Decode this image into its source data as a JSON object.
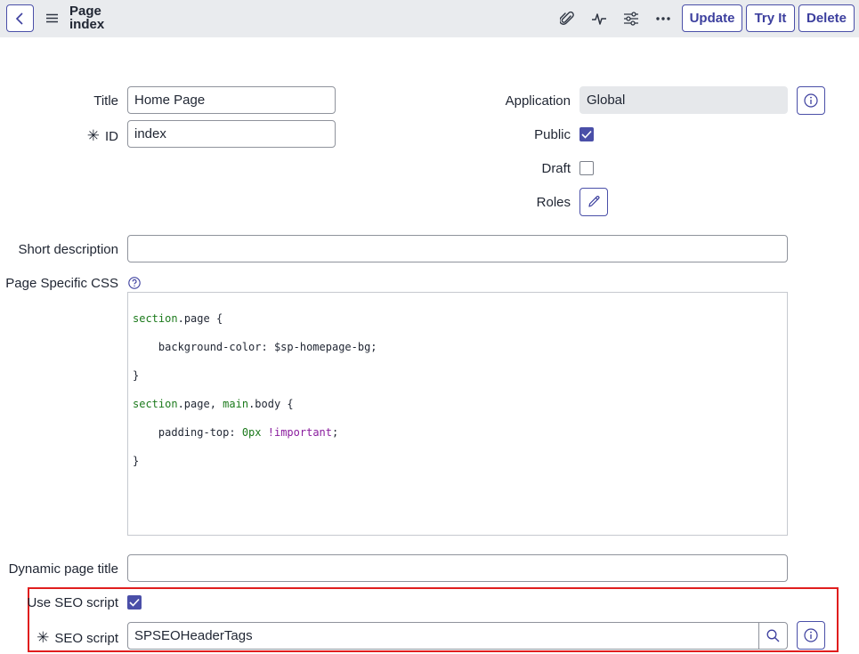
{
  "header": {
    "title_line1": "Page",
    "title_line2": "index",
    "icons": [
      "back-arrow-icon",
      "hamburger-menu-icon",
      "paperclip-icon",
      "activity-pulse-icon",
      "sliders-icon",
      "more-ellipsis-icon"
    ],
    "buttons": {
      "update": "Update",
      "try_it": "Try It",
      "delete": "Delete"
    }
  },
  "form": {
    "title": {
      "label": "Title",
      "value": "Home Page"
    },
    "id": {
      "label": "ID",
      "required_mark": "✳",
      "value": "index"
    },
    "application": {
      "label": "Application",
      "value": "Global"
    },
    "public": {
      "label": "Public",
      "checked": true
    },
    "draft": {
      "label": "Draft",
      "checked": false
    },
    "roles": {
      "label": "Roles"
    },
    "short_description": {
      "label": "Short description",
      "value": ""
    },
    "page_css": {
      "label": "Page Specific CSS",
      "code_lines": [
        "section.page {",
        "    background-color: $sp-homepage-bg;",
        "}",
        "section.page, main.body {",
        "    padding-top: 0px !important;",
        "}"
      ]
    },
    "dynamic_page_title": {
      "label": "Dynamic page title",
      "value": ""
    },
    "use_seo_script": {
      "label": "Use SEO script",
      "checked": true
    },
    "seo_script": {
      "label": "SEO script",
      "required_mark": "✳",
      "value": "SPSEOHeaderTags"
    }
  },
  "colors": {
    "accent": "#4a4fa8",
    "highlight": "#e01e1e",
    "header_bg": "#e9ebee"
  }
}
